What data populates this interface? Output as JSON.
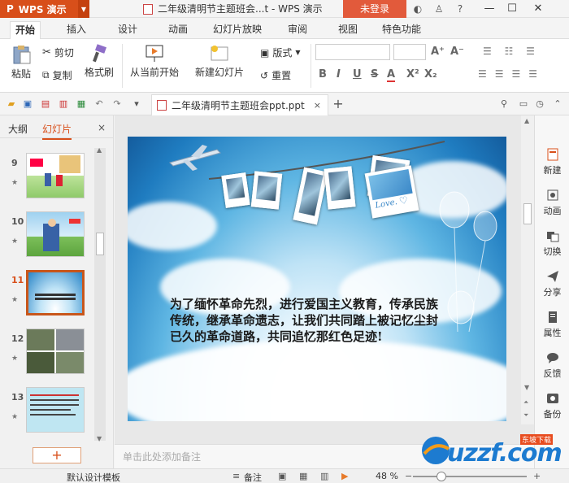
{
  "titlebar": {
    "app_name": "WPS 演示",
    "logo": "P",
    "document_title": "二年级清明节主题班会...t - WPS 演示",
    "login_label": "未登录",
    "icons": [
      "skin-icon",
      "shirt-icon",
      "help-icon"
    ],
    "window_controls": [
      "minimize",
      "maximize",
      "close"
    ]
  },
  "menu": {
    "tabs": [
      "开始",
      "插入",
      "设计",
      "动画",
      "幻灯片放映",
      "审阅",
      "视图",
      "特色功能"
    ],
    "active": "开始"
  },
  "ribbon": {
    "paste": "粘贴",
    "cut": "剪切",
    "copy": "复制",
    "format_painter": "格式刷",
    "from_current": "从当前开始",
    "new_slide": "新建幻灯片",
    "layout": "版式",
    "reset": "重置",
    "bold": "B",
    "italic": "I",
    "underline": "U",
    "strike": "S",
    "font_color": "A",
    "superscript": "X²",
    "subscript": "X₂"
  },
  "quickbar": {
    "doc_tab_title": "二年级清明节主题班会ppt.ppt",
    "close_symbol": "×",
    "add_symbol": "+"
  },
  "left_panel": {
    "tab_outline": "大纲",
    "tab_slides": "幻灯片",
    "close_symbol": "×",
    "thumbnails": [
      {
        "num": "9",
        "star": "★"
      },
      {
        "num": "10",
        "star": "★"
      },
      {
        "num": "11",
        "star": "★"
      },
      {
        "num": "12",
        "star": "★"
      },
      {
        "num": "13",
        "star": "★"
      }
    ],
    "selected_slide": "11",
    "add_button": "+"
  },
  "slide": {
    "text": "为了缅怀革命先烈，进行爱国主义教育，传承民族传统，继承革命遗志，让我们共同踏上被记忆尘封已久的革命道路，共同追忆那红色足迹!",
    "photo_caption": "Love."
  },
  "notes": {
    "placeholder": "单击此处添加备注"
  },
  "right_panel": {
    "items": [
      "新建",
      "动画",
      "切换",
      "分享",
      "属性",
      "反馈",
      "备份"
    ]
  },
  "statusbar": {
    "template": "默认设计模板",
    "notes_label": "备注",
    "zoom": "48 %",
    "zoom_fraction": 0.25
  },
  "watermark": {
    "brand": "uzzf.com",
    "tag": "东坡下载"
  }
}
